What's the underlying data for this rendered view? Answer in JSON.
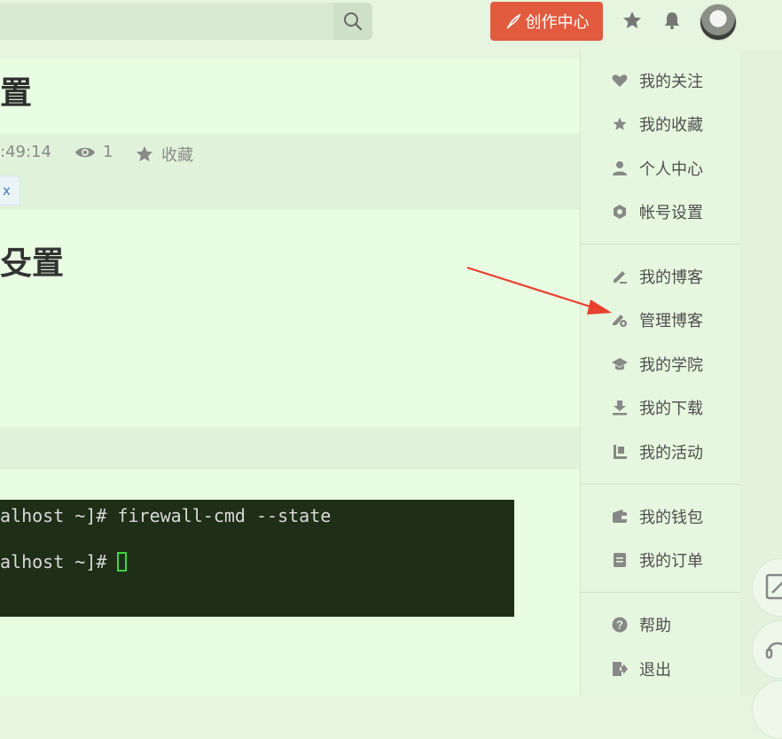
{
  "topbar": {
    "create_label": "创作中心"
  },
  "article": {
    "title_fragment": "置",
    "meta": {
      "time": ":49:14",
      "views": "1",
      "favorite": "收藏"
    },
    "tag": "x",
    "heading_fragment": "殳置"
  },
  "terminal": {
    "lines": [
      "alhost ~]# firewall-cmd --state",
      "alhost ~]# "
    ]
  },
  "menu": {
    "groups": [
      [
        {
          "label": "我的关注",
          "icon": "heart-icon"
        },
        {
          "label": "我的收藏",
          "icon": "star-icon"
        },
        {
          "label": "个人中心",
          "icon": "user-icon"
        },
        {
          "label": "帐号设置",
          "icon": "settings-icon"
        }
      ],
      [
        {
          "label": "我的博客",
          "icon": "edit-icon"
        },
        {
          "label": "管理博客",
          "icon": "manage-blog-icon"
        },
        {
          "label": "我的学院",
          "icon": "graduation-cap-icon"
        },
        {
          "label": "我的下载",
          "icon": "download-icon"
        },
        {
          "label": "我的活动",
          "icon": "activity-icon"
        }
      ],
      [
        {
          "label": "我的钱包",
          "icon": "wallet-icon"
        },
        {
          "label": "我的订单",
          "icon": "order-icon"
        }
      ],
      [
        {
          "label": "帮助",
          "icon": "help-icon"
        },
        {
          "label": "退出",
          "icon": "logout-icon"
        }
      ]
    ]
  },
  "colors": {
    "accent": "#e25b3f",
    "page_bg": "#e6f5df",
    "terminal_bg": "#1e2e17",
    "annotation_arrow": "#e8402f"
  }
}
